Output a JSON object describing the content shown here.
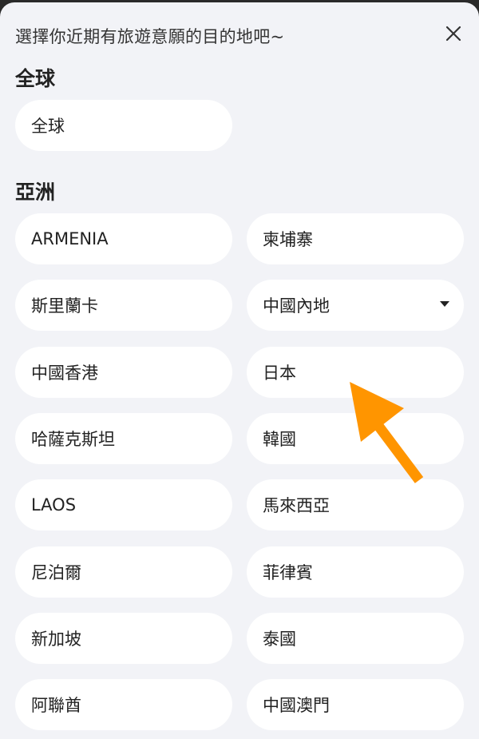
{
  "header": {
    "title": "選擇你近期有旅遊意願的目的地吧~",
    "close_icon": "close-icon"
  },
  "sections": [
    {
      "title": "全球",
      "items": [
        {
          "label": "全球"
        }
      ]
    },
    {
      "title": "亞洲",
      "items": [
        {
          "label": "ARMENIA"
        },
        {
          "label": "柬埔寨"
        },
        {
          "label": "斯里蘭卡"
        },
        {
          "label": "中國內地",
          "has_dropdown": true
        },
        {
          "label": "中國香港"
        },
        {
          "label": "日本"
        },
        {
          "label": "哈薩克斯坦"
        },
        {
          "label": "韓國"
        },
        {
          "label": "LAOS"
        },
        {
          "label": "馬來西亞"
        },
        {
          "label": "尼泊爾"
        },
        {
          "label": "菲律賓"
        },
        {
          "label": "新加坡"
        },
        {
          "label": "泰國"
        },
        {
          "label": "阿聯酋"
        },
        {
          "label": "中國澳門"
        }
      ]
    }
  ],
  "colors": {
    "background": "#f2f3f7",
    "chip": "#ffffff",
    "arrow": "#ff9500"
  }
}
